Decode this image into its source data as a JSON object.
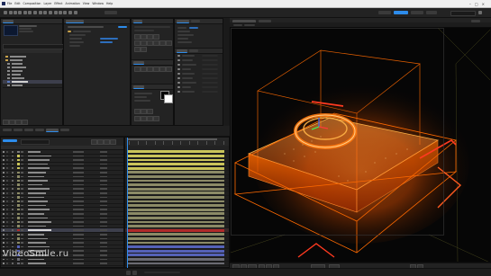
{
  "app": {
    "menu": [
      "File",
      "Edit",
      "Composition",
      "Layer",
      "Effect",
      "Animation",
      "View",
      "Window",
      "Help"
    ],
    "window_controls": [
      "–",
      "□",
      "×"
    ]
  },
  "watermark": "VideoSmile.ru",
  "colors": {
    "accent": "#2d8ceb",
    "glow": "#ff6a00",
    "glow_hot": "#ffb347",
    "track_yellow": "#c9c45a",
    "track_olive": "#8b8a66",
    "track_red": "#b02a2a",
    "track_blue": "#5562b8",
    "track_gray": "#6b6b72"
  },
  "layers": {
    "rows": [
      {
        "swatch": "#7c7c7c",
        "track": "#c9c45a"
      },
      {
        "swatch": "#c9c45a",
        "track": "#c9c45a"
      },
      {
        "swatch": "#c9c45a",
        "track": "#c9c45a"
      },
      {
        "swatch": "#c9c45a",
        "track": "#c9c45a"
      },
      {
        "swatch": "#c9c45a",
        "track": "#c9c45a"
      },
      {
        "swatch": "#8b8a66",
        "track": "#8b8a66"
      },
      {
        "swatch": "#8b8a66",
        "track": "#8b8a66"
      },
      {
        "swatch": "#8b8a66",
        "track": "#8b8a66"
      },
      {
        "swatch": "#8b8a66",
        "track": "#8b8a66"
      },
      {
        "swatch": "#8b8a66",
        "track": "#8b8a66"
      },
      {
        "swatch": "#8b8a66",
        "track": "#8b8a66"
      },
      {
        "swatch": "#8b8a66",
        "track": "#8b8a66"
      },
      {
        "swatch": "#8b8a66",
        "track": "#8b8a66"
      },
      {
        "swatch": "#8b8a66",
        "track": "#8b8a66"
      },
      {
        "swatch": "#8b8a66",
        "track": "#8b8a66"
      },
      {
        "swatch": "#8b8a66",
        "track": "#8b8a66"
      },
      {
        "swatch": "#8b8a66",
        "track": "#8b8a66"
      },
      {
        "swatch": "#8b8a66",
        "track": "#8b8a66"
      },
      {
        "swatch": "#8b8a66",
        "track": "#8b8a66"
      },
      {
        "swatch": "#b02a2a",
        "track": "#b02a2a",
        "selected": true
      },
      {
        "swatch": "#8b8a66",
        "track": "#8b8a66"
      },
      {
        "swatch": "#8b8a66",
        "track": "#8b8a66"
      },
      {
        "swatch": "#8b8a66",
        "track": "#8b8a66"
      },
      {
        "swatch": "#5562b8",
        "track": "#5562b8"
      },
      {
        "swatch": "#5562b8",
        "track": "#5562b8"
      },
      {
        "swatch": "#5562b8",
        "track": "#5562b8"
      },
      {
        "swatch": "#6b6b72",
        "track": "#6b6b72"
      },
      {
        "swatch": "#6b6b72",
        "track": "#6b6b72"
      }
    ]
  }
}
